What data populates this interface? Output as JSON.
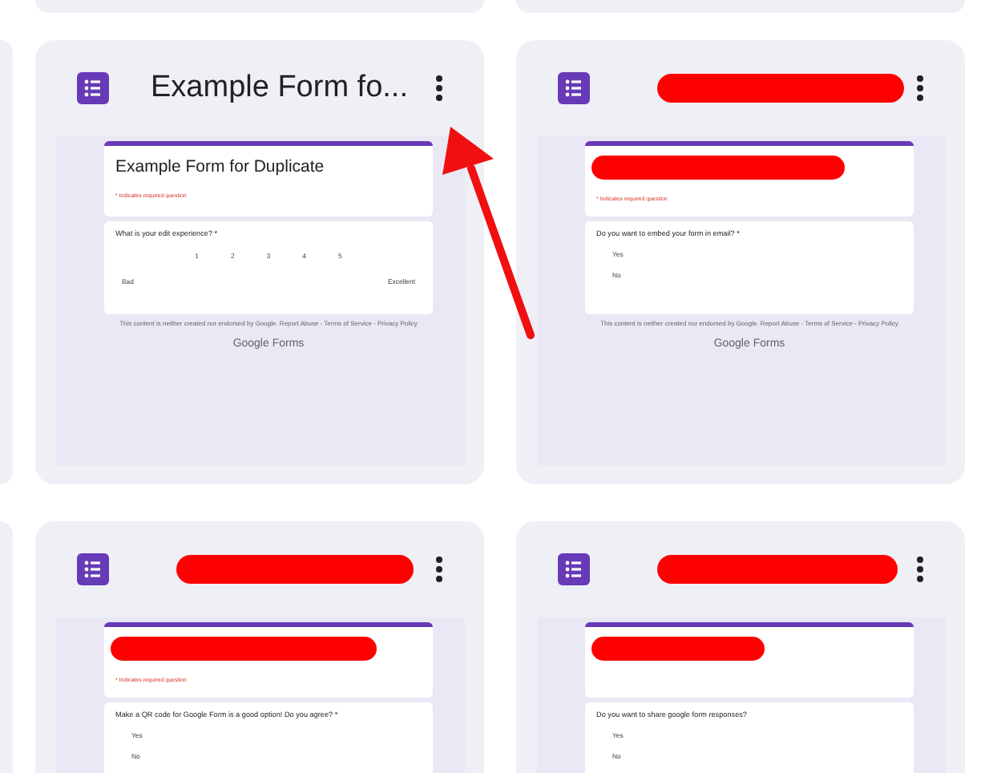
{
  "cards": [
    {
      "title": "Example Form fo...",
      "title_redacted": false,
      "preview": {
        "title": "Example Form for Duplicate",
        "title_redacted": false,
        "required_note": "* Indicates required question",
        "question": {
          "kind": "scale",
          "text": "What is your edit experience? *",
          "scale": [
            "1",
            "2",
            "3",
            "4",
            "5"
          ],
          "low": "Bad",
          "high": "Excellent"
        },
        "footer": "This content is neither created nor endorsed by Google. Report Abuse - Terms of Service - Privacy Policy",
        "brand": "Google Forms"
      }
    },
    {
      "title_redacted": true,
      "preview": {
        "title_redacted": true,
        "required_note": "* Indicates required question",
        "question": {
          "kind": "choice",
          "text": "Do you want to embed your form in email? *",
          "options": [
            "Yes",
            "No"
          ]
        },
        "footer": "This content is neither created nor endorsed by Google. Report Abuse - Terms of Service - Privacy Policy",
        "brand": "Google Forms"
      }
    },
    {
      "title_redacted": true,
      "preview": {
        "title_redacted": true,
        "required_note": "* Indicates required question",
        "question": {
          "kind": "choice",
          "text": "Make a QR code for Google Form is a good option! Do you agree? *",
          "options": [
            "Yes",
            "No"
          ]
        }
      }
    },
    {
      "title_redacted": true,
      "preview": {
        "title_redacted": true,
        "question": {
          "kind": "choice",
          "text": "Do you want to share google form responses?",
          "options": [
            "Yes",
            "No"
          ]
        }
      }
    }
  ]
}
